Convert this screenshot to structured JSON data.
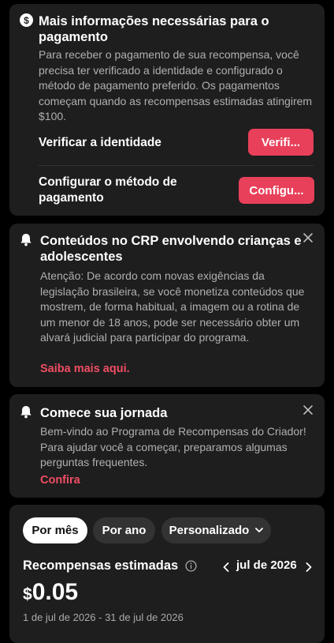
{
  "payment_card": {
    "title": "Mais informações necessárias para o pagamento",
    "description": "Para receber o pagamento de sua recompensa, você precisa ter verificado a identidade e configurado o método de pagamento preferido. Os pagamentos começam quando as recompensas estimadas atingirem $100.",
    "verify_label": "Verificar a identidade",
    "verify_button": "Verifi...",
    "method_label": "Configurar o método de pagamento",
    "method_button": "Configu..."
  },
  "crp_card": {
    "title": "Conteúdos no CRP envolvendo crianças e adolescentes",
    "description": "Atenção: De acordo com novas exigências da legislação brasileira, se você monetiza conteúdos que mostrem, de forma habitual, a imagem ou a rotina de um menor de 18 anos, pode ser necessário obter um alvará judicial para participar do programa.",
    "link": "Saiba mais aqui."
  },
  "journey_card": {
    "title": "Comece sua jornada",
    "description": "Bem-vindo ao Programa de Recompensas do Criador! Para ajudar você a começar, preparamos algumas perguntas frequentes.",
    "link": "Confira"
  },
  "rewards": {
    "tabs": [
      "Por mês",
      "Por ano",
      "Personalizado"
    ],
    "active_tab": "Por mês",
    "title": "Recompensas estimadas",
    "month": "jul de 2026",
    "currency": "$",
    "amount": "0.05",
    "date_range": "1 de jul de 2026 - 31 de jul de 2026"
  },
  "colors": {
    "accent": "#e8405a",
    "card_bg": "#1e1e1e",
    "background": "#000000"
  }
}
